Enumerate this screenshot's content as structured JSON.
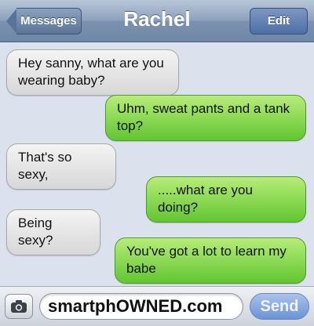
{
  "header": {
    "back_label": "Messages",
    "title": "Rachel",
    "edit_label": "Edit"
  },
  "messages": [
    {
      "direction": "received",
      "text": "Hey sanny, what are you wearing baby?"
    },
    {
      "direction": "sent",
      "text": "Uhm, sweat pants and a tank top?"
    },
    {
      "direction": "received",
      "text": "That's so sexy,"
    },
    {
      "direction": "sent",
      "text": ".....what are you doing?"
    },
    {
      "direction": "received",
      "text": "Being sexy?"
    },
    {
      "direction": "sent",
      "text": "You've got a lot to learn my babe"
    }
  ],
  "input": {
    "value": "smartphOWNED.com",
    "send_label": "Send",
    "camera_icon": "camera-icon"
  }
}
